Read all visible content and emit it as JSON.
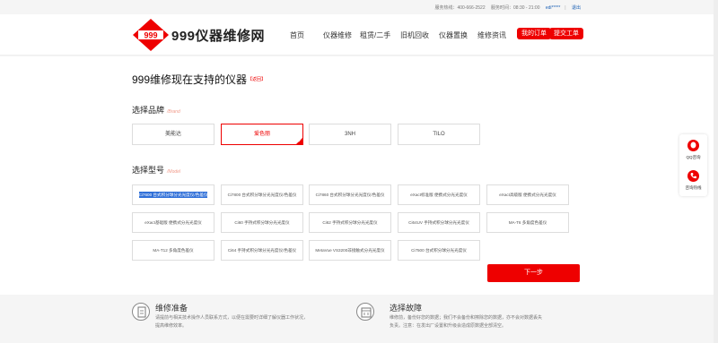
{
  "topbar": {
    "hotline_label": "服务热线：400-666-2522",
    "hours_label": "服务时间：08:30 - 21:00",
    "user": "edi*****",
    "logout": "退出"
  },
  "header": {
    "logo_text": "999仪器维修网",
    "logo_mark": "999",
    "nav": [
      "首页",
      "仪器维修",
      "租赁/二手",
      "旧机回收",
      "仪器置换",
      "维修资讯"
    ],
    "my_orders": "我的订单",
    "submit_ticket": "提交工单"
  },
  "page": {
    "title": "999维修现在支持的仪器",
    "return_link": "【返回】"
  },
  "brand_section": {
    "title": "选择品牌",
    "title_en": "/Brand",
    "brands": [
      {
        "label": "美能达",
        "selected": false
      },
      {
        "label": "爱色丽",
        "selected": true
      },
      {
        "label": "3NH",
        "selected": false
      },
      {
        "label": "TILO",
        "selected": false
      }
    ]
  },
  "model_section": {
    "title": "选择型号",
    "title_en": "/Model",
    "models": [
      {
        "label": "Ci7600 台式积分球分光光度仪/色差仪",
        "selected": true
      },
      {
        "label": "Ci7800 台式积分球分光光度仪/色差仪",
        "selected": false
      },
      {
        "label": "Ci7860 台式积分球分光光度仪/色差仪",
        "selected": false
      },
      {
        "label": "eXact标准版 便携式分光光度仪",
        "selected": false
      },
      {
        "label": "eXact高级版 便携式分光光度仪",
        "selected": false
      },
      {
        "label": "eXact基础版 便携式分光光度仪",
        "selected": false
      },
      {
        "label": "Ci60 手持式积分球分光光度仪",
        "selected": false
      },
      {
        "label": "Ci62 手持式积分球分光光度仪",
        "selected": false
      },
      {
        "label": "Ci64UV 手持式积分球分光光度仪",
        "selected": false
      },
      {
        "label": "MA-T6 多角度色差仪",
        "selected": false
      },
      {
        "label": "MA-T12 多角度色差仪",
        "selected": false
      },
      {
        "label": "Ci64 手持式积分球分光光度仪/色差仪",
        "selected": false
      },
      {
        "label": "MetaVue VS3200非接触式分光光度仪",
        "selected": false
      },
      {
        "label": "Ci7500 台式积分球分光光度仪",
        "selected": false
      }
    ],
    "next_button": "下一步"
  },
  "features": [
    {
      "title": "维修准备",
      "icon": "document-icon",
      "desc": "请提前与相关技术操作人员联系方式，以便在需要时详细了解仪器工作状况，提高维修效率。"
    },
    {
      "title": "选择故障",
      "icon": "calendar-icon",
      "desc": "维修前，备份好您的数据；我们不会备份和擦除您的数据，亦不会对数据丢失负责。注意：在发出厂设置和升级会造成原数据全部清空。"
    }
  ],
  "float_panel": {
    "qq_label": "QQ咨询",
    "phone_label": "咨询热线"
  },
  "colors": {
    "accent": "#e00000",
    "selected_highlight": "#2f6fd8"
  }
}
